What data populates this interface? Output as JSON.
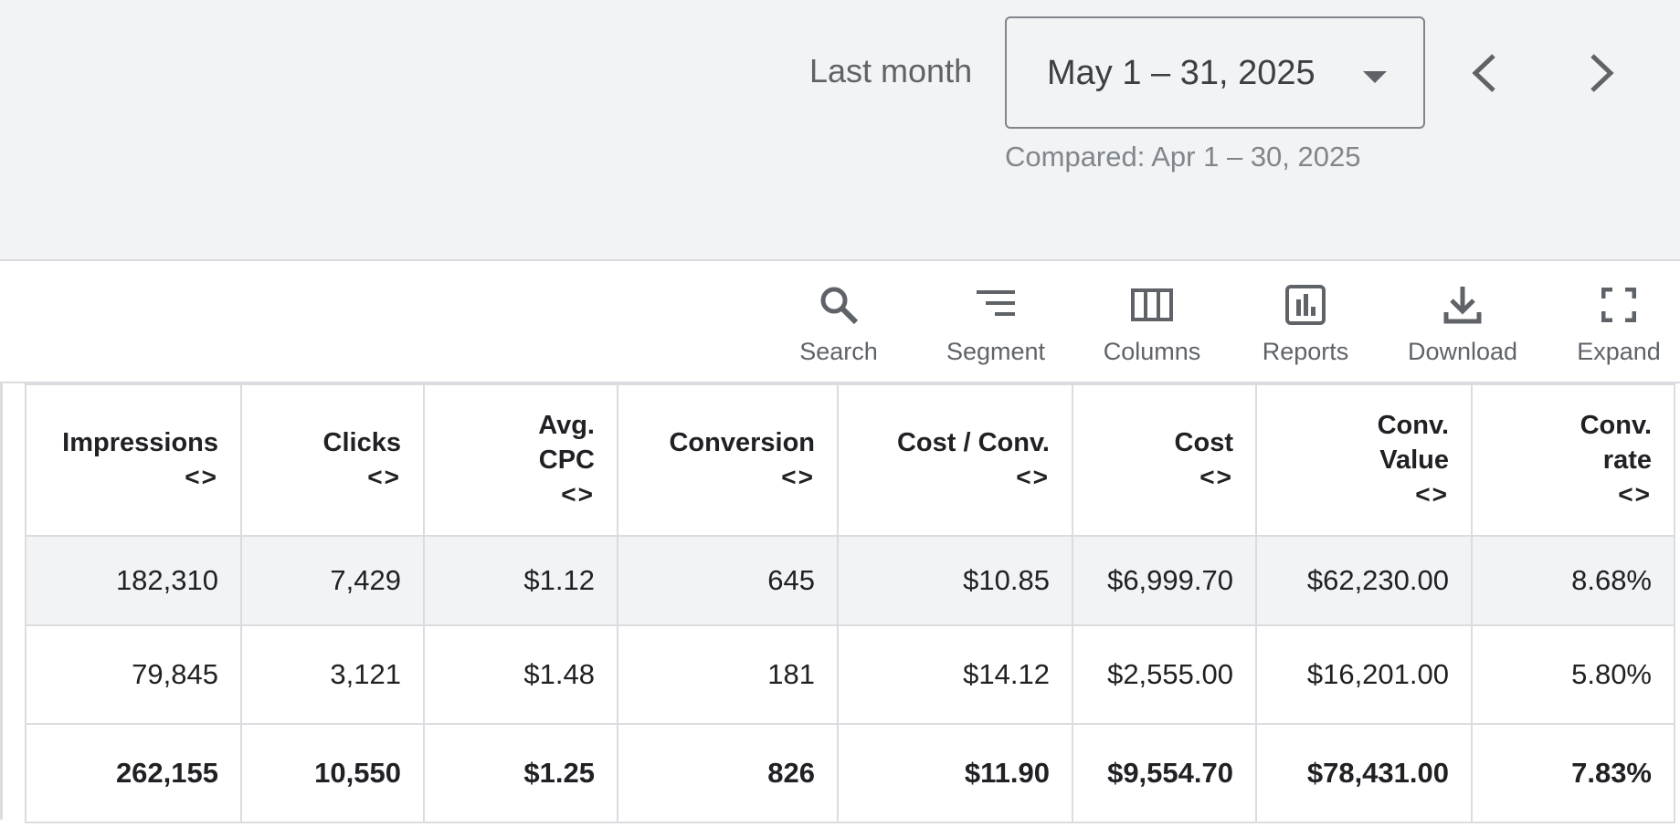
{
  "header": {
    "range_label": "Last month",
    "date_range": "May 1 – 31, 2025",
    "compared": "Compared: Apr 1 – 30, 2025",
    "prev_icon": "chevron-left-icon",
    "next_icon": "chevron-right-icon"
  },
  "toolbar": {
    "search": "Search",
    "segment": "Segment",
    "columns": "Columns",
    "reports": "Reports",
    "download": "Download",
    "expand": "Expand"
  },
  "table": {
    "columns": [
      {
        "line1": "",
        "line2": "Impressions",
        "sort": "<>"
      },
      {
        "line1": "",
        "line2": "Clicks",
        "sort": "<>"
      },
      {
        "line1": "Avg.",
        "line2": "CPC",
        "sort": "<>"
      },
      {
        "line1": "",
        "line2": "Conversion",
        "sort": "<>"
      },
      {
        "line1": "",
        "line2": "Cost / Conv.",
        "sort": "<>"
      },
      {
        "line1": "",
        "line2": "Cost",
        "sort": "<>"
      },
      {
        "line1": "Conv.",
        "line2": "Value",
        "sort": "<>"
      },
      {
        "line1": "Conv.",
        "line2": "rate",
        "sort": "<>"
      }
    ],
    "rows": [
      [
        "182,310",
        "7,429",
        "$1.12",
        "645",
        "$10.85",
        "$6,999.70",
        "$62,230.00",
        "8.68%"
      ],
      [
        "79,845",
        "3,121",
        "$1.48",
        "181",
        "$14.12",
        "$2,555.00",
        "$16,201.00",
        "5.80%"
      ]
    ],
    "total": [
      "262,155",
      "10,550",
      "$1.25",
      "826",
      "$11.90",
      "$9,554.70",
      "$78,431.00",
      "7.83%"
    ]
  }
}
